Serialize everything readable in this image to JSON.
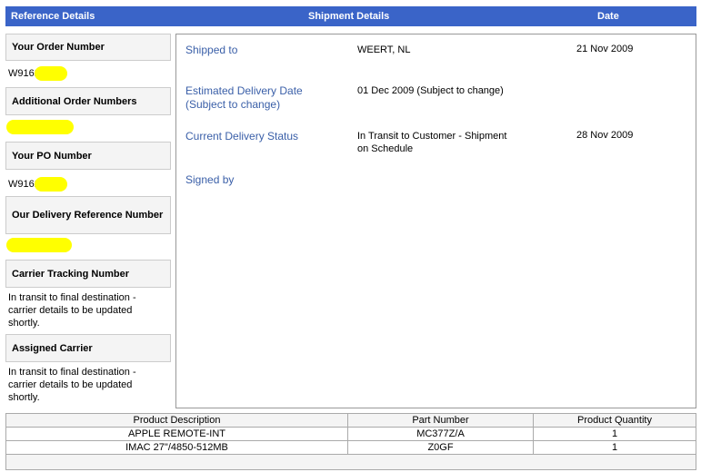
{
  "header": {
    "reference": "Reference Details",
    "shipment": "Shipment Details",
    "date": "Date"
  },
  "reference": {
    "order_number_label": "Your Order Number",
    "order_number_value": "W9162",
    "additional_label": "Additional Order Numbers",
    "po_label": "Your PO Number",
    "po_value": "W9162",
    "delivery_ref_label": "Our Delivery Reference Number",
    "carrier_tracking_label": "Carrier Tracking Number",
    "carrier_tracking_value": "In transit to final destination - carrier details to be updated shortly.",
    "assigned_carrier_label": "Assigned Carrier",
    "assigned_carrier_value": "In transit to final destination - carrier details to be updated shortly."
  },
  "shipment": [
    {
      "label": "Shipped to",
      "value": "WEERT, NL",
      "date": "21 Nov 2009"
    },
    {
      "label": "Estimated Delivery Date (Subject to change)",
      "value": "01 Dec 2009 (Subject to change)",
      "date": ""
    },
    {
      "label": "Current Delivery Status",
      "value": "In Transit to Customer - Shipment on Schedule",
      "date": "28 Nov 2009"
    },
    {
      "label": "Signed by",
      "value": "",
      "date": ""
    }
  ],
  "products": {
    "columns": [
      "Product Description",
      "Part Number",
      "Product Quantity"
    ],
    "rows": [
      [
        "APPLE REMOTE-INT",
        "MC377Z/A",
        "1"
      ],
      [
        "IMAC 27\"/4850-512MB",
        "Z0GF",
        "1"
      ]
    ]
  },
  "colors": {
    "header": "#3a64c8",
    "label": "#3a5fa8",
    "redaction": "#ffff00"
  }
}
